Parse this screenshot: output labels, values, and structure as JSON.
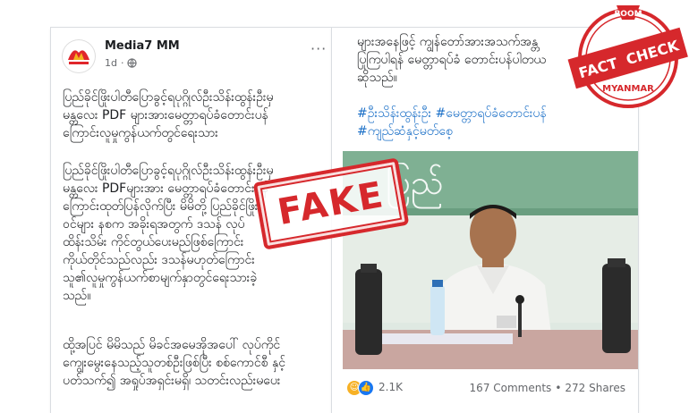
{
  "post": {
    "author": "Media7 MM",
    "time": "1d",
    "dot": "·",
    "more": "···",
    "paragraph1": "ပြည်ခိုင်ဖြိုးပါတီပြောခွင့်ရပုဂ္ဂိုလ်ဦးသိန်းထွန်းဦးမှ\nမန္တလေး PDF များအားမေတ္တာရပ်ခံတောင်းပန်\nကြောင်းလူမှုကွန်ယက်တွင်ရေးသား",
    "paragraph2": "ပြည်ခိုင်ဖြိုးပါတီပြောခွင့်ရပုဂ္ဂိုလ်ဦးသိန်းထွန်းဦးမှ\n မန္တလေး PDFများအား မေတ္တာရပ်ခံတောင်းပန်\nကြောင်းထုတ်ပြန်လိုက်ပြီး မိမိတို့ ပြည်ခိုင်ဖြိုး\nဝင်များ နစက အခိုးရအတွက် ဒသန် လုပ်\nထိန်းသိမ်း ကိုင်တွယ်ပေးမည်ဖြစ်ကြောင်း\nကိုယ်တိုင်သည်လည်း ဒသန်မဟုတ်ကြောင်း\nသူ၏လူမှုကွန်ယက်စာမျက်နှာတွင်ရေးသားခဲ့\nသည်။",
    "paragraph3": "ထို့အပြင် မိမိသည် မိခင်အမေအိုအပေါ် လုပ်ကိုင်\nကျွေးမွေးနေသည့်သူတစ်ဦးဖြစ်ပြီး စစ်ကောင်စီ နှင့်\nပတ်သက်၍ အရှုပ်အရှင်းမရှိ၊ သတင်းလည်းမပေး",
    "right_text": "များအနေဖြင့် ကျွန်တော်အားအသက်အန္တ\nပြုကြပါရန် မေတ္တာရပ်ခံ တောင်းပန်ပါတယ\nဆိုသည်။",
    "hashtags": "#ဦးသိန်းထွန်းဦး #မေတ္တာရပ်ခံတောင်းပန်\n#ကျည်ဆံနှင့်မတ်စေ့",
    "reaction_count": "2.1K",
    "comments": "167 Comments",
    "shares": "272 Shares",
    "stats_sep": "•",
    "photo_bg_text": "ပြည်"
  },
  "stamps": {
    "fake": "FAKE",
    "badge_top": "BOOM",
    "badge_main_1": "FACT",
    "badge_main_2": "CHECK",
    "badge_bottom": "MYANMAR"
  },
  "colors": {
    "fb_blue": "#1877f2",
    "hashtag": "#1a6fc7",
    "stamp_red": "#d6282c"
  }
}
